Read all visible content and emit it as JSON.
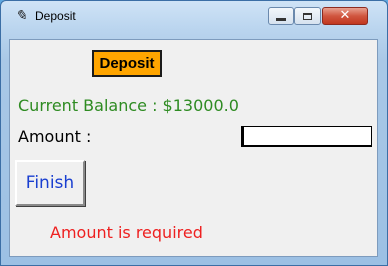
{
  "window": {
    "title": "Deposit",
    "app_icon": "feather-icon",
    "controls": {
      "minimize": "minimize-icon",
      "maximize": "maximize-icon",
      "close": "close-icon",
      "close_glyph": "✕"
    }
  },
  "form": {
    "heading": "Deposit",
    "balance_text": "Current Balance : $13000.0",
    "amount_label": "Amount :",
    "amount_value": "",
    "finish_label": "Finish",
    "error_text": "Amount is required"
  },
  "colors": {
    "heading_bg": "#ffa500",
    "balance_text": "#2e8b22",
    "finish_text": "#1a3fd0",
    "error_text": "#ee2020",
    "close_button": "#c1371f"
  }
}
